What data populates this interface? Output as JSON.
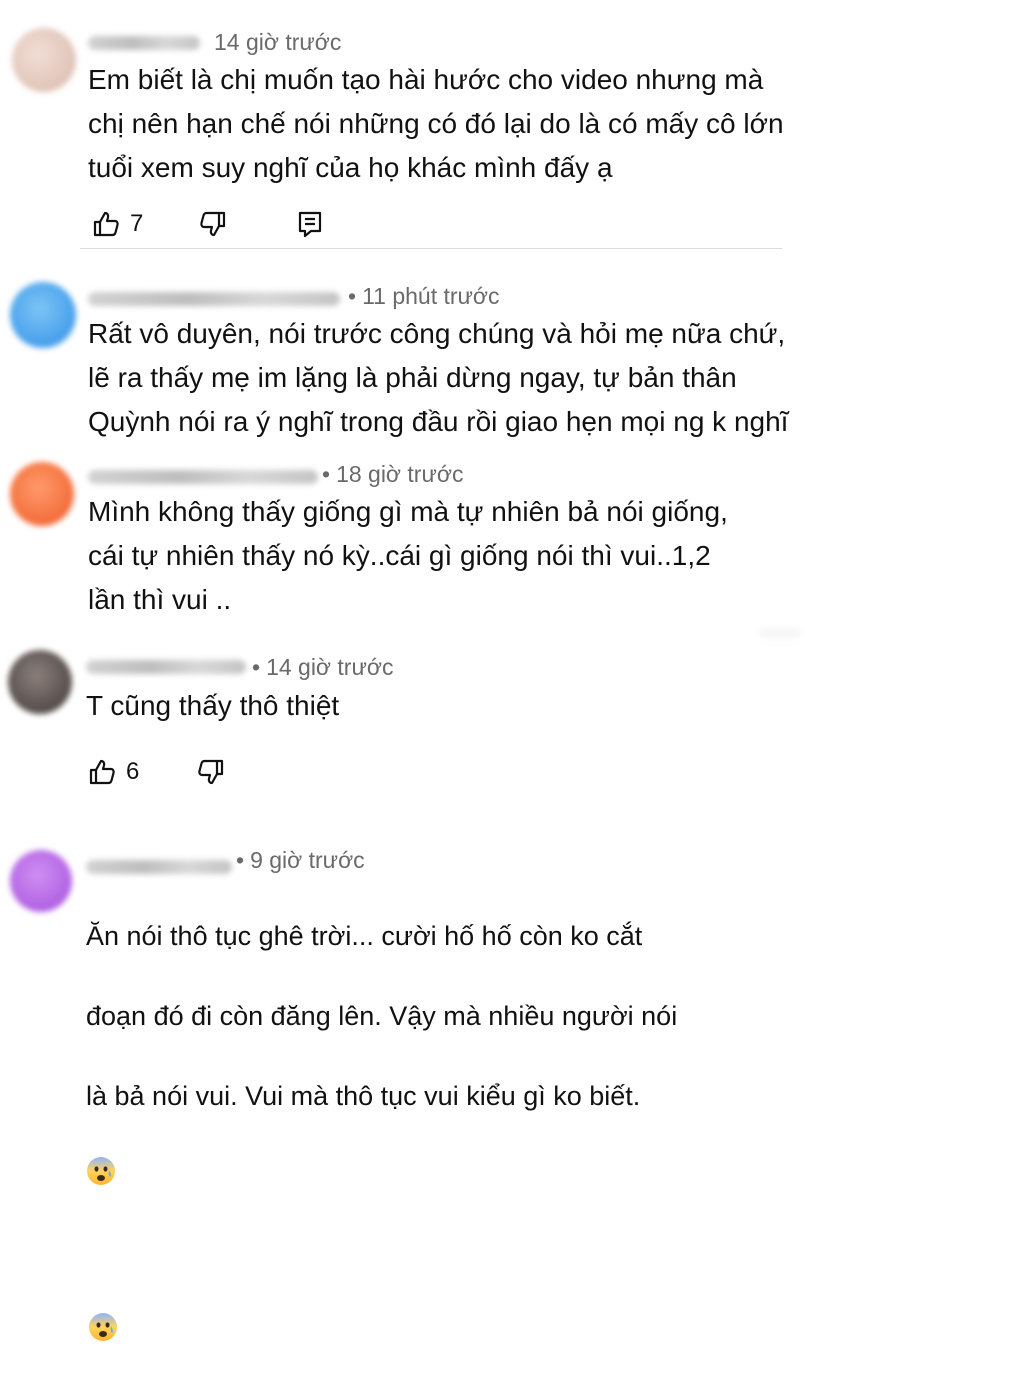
{
  "comments": [
    {
      "time": "14 giờ trước",
      "text": "Em biết là chị muốn tạo hài hước cho video nhưng mà\nchị nên hạn chế nói những có đó lại do là có mấy cô lớn\ntuổi xem suy nghĩ của họ khác mình đấy ạ",
      "likes": "7",
      "avatar_color": "#e6cfc6"
    },
    {
      "time": "11 phút trước",
      "text": "Rất vô duyên, nói trước công chúng và hỏi mẹ nữa chứ,\nlẽ ra thấy mẹ im lặng là phải dừng ngay, tự bản thân\nQuỳnh nói ra ý nghĩ trong đầu rồi giao hẹn mọi ng k nghĩ",
      "avatar_color": "#3d9be9"
    },
    {
      "time": "18 giờ trước",
      "text": "Mình không thấy giống gì mà tự nhiên bả nói giống,\ncái tự nhiên thấy nó kỳ..cái gì giống nói thì vui..1,2\nlần thì vui ..",
      "avatar_color": "#f26a35"
    },
    {
      "time": "14 giờ trước",
      "text": "T cũng thấy thô thiệt",
      "likes": "6",
      "avatar_color": "#5a5453"
    },
    {
      "time": "9 giờ trước",
      "text_line1": "Ăn nói thô tục ghê trời... cười hố hố còn ko cắt",
      "text_line2": "đoạn đó đi còn đăng lên. Vậy mà nhiều người nói",
      "text_line3": "là bả nói vui. Vui mà thô tục vui kiểu gì ko biết.",
      "avatar_color": "#b05ce3"
    }
  ],
  "separator": "•",
  "icons": {
    "like": "thumb-up-icon",
    "dislike": "thumb-down-icon",
    "reply": "reply-icon",
    "emoji": "anxious-face-emoji"
  }
}
